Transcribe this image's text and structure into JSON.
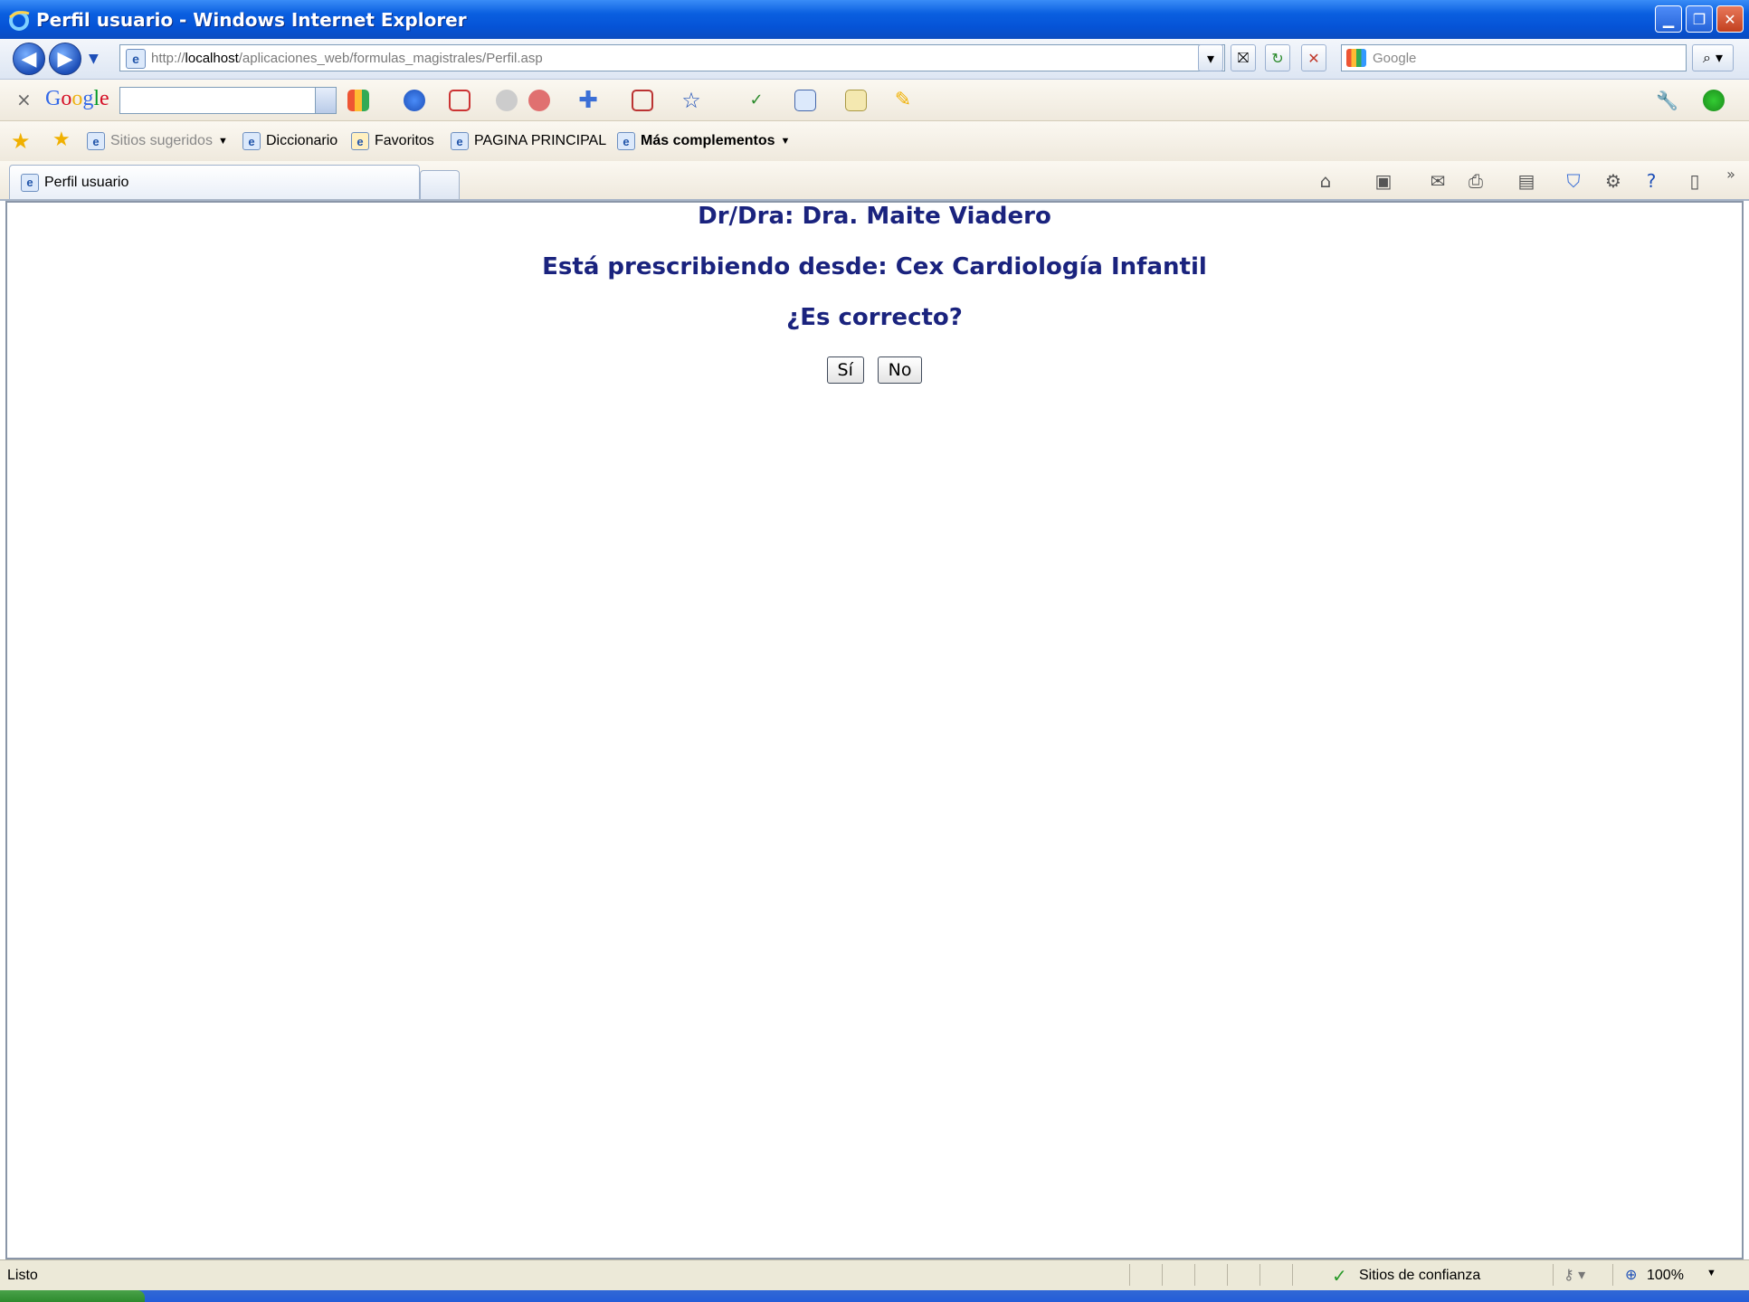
{
  "window": {
    "title": "Perfil usuario - Windows Internet Explorer",
    "buttons": [
      "minimize",
      "restore",
      "close"
    ]
  },
  "address_bar": {
    "prefix": "http://",
    "host": "localhost",
    "path": "/aplicaciones_web/formulas_magistrales/Perfil.asp"
  },
  "search_box": {
    "placeholder": "Google"
  },
  "google_toolbar": {
    "logo": "Google"
  },
  "favorites_bar": {
    "items": [
      "Sitios sugeridos",
      "Diccionario",
      "Favoritos",
      "PAGINA PRINCIPAL",
      "Más complementos"
    ]
  },
  "tabs": [
    {
      "label": "Perfil usuario"
    }
  ],
  "page": {
    "doctor_line": "Dr/Dra: Dra. Maite Viadero",
    "location_line": "Está prescribiendo desde: Cex Cardiología Infantil",
    "question": "¿Es correcto?",
    "yes_label": "Sí",
    "no_label": "No"
  },
  "status_bar": {
    "status": "Listo",
    "zone": "Sitios de confianza",
    "zoom": "100%"
  },
  "colors": {
    "titlebar": "#0553d6",
    "heading_text": "#1a237e"
  }
}
